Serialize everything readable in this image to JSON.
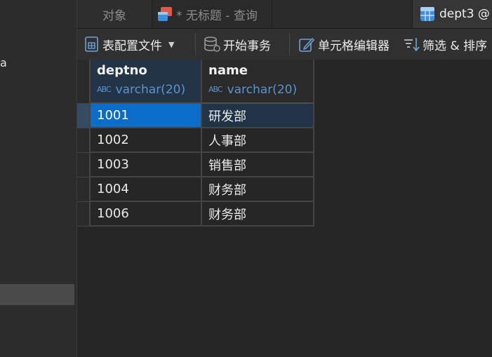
{
  "left_pane": {
    "fragment_text": "a"
  },
  "tabs": [
    {
      "label": "对象"
    },
    {
      "label": "* 无标题 - 查询"
    },
    {
      "label": "dept3 @"
    }
  ],
  "toolbar": {
    "profile_label": "表配置文件",
    "transaction_label": "开始事务",
    "editor_label": "单元格编辑器",
    "filter_label": "筛选 & 排序"
  },
  "grid": {
    "columns": [
      {
        "name": "deptno",
        "type": "varchar(20)"
      },
      {
        "name": "name",
        "type": "varchar(20)"
      }
    ],
    "rows": [
      {
        "deptno": "1001",
        "name": "研发部"
      },
      {
        "deptno": "1002",
        "name": "人事部"
      },
      {
        "deptno": "1003",
        "name": "销售部"
      },
      {
        "deptno": "1004",
        "name": "财务部"
      },
      {
        "deptno": "1006",
        "name": "财务部"
      }
    ],
    "type_icon_text": "ABC"
  },
  "colors": {
    "selected_cell": "#0a6dc9",
    "selected_row": "#213447",
    "type_text": "#5b93cf"
  }
}
